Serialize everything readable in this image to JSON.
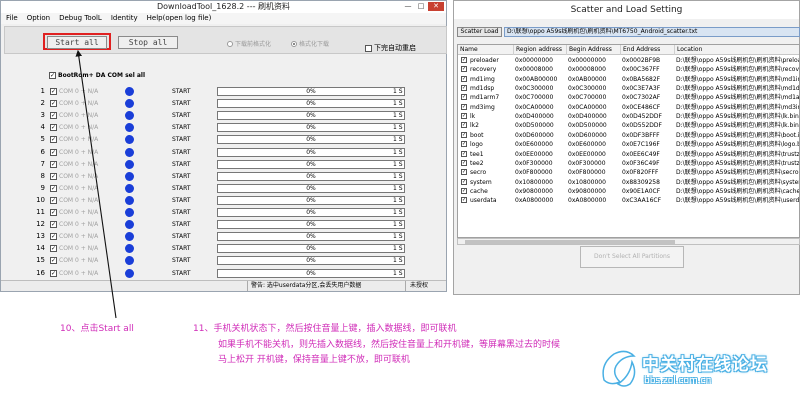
{
  "download_tool": {
    "title": "DownloadTool_1628.2 --- 刷机资料",
    "window_buttons": {
      "minimize": "—",
      "maximize": "□",
      "close": "✕"
    },
    "menu": [
      "File",
      "Option",
      "Debug ToolL",
      "Identity",
      "Help(open log file)"
    ],
    "start_all": "Start all",
    "stop_all": "Stop all",
    "radio_1": "下载前格式化",
    "radio_2": "格式化下载",
    "auto_reboot": "下完自动重启",
    "bootrom_label": "BootRom+ DA COM sel all",
    "ports": [
      {
        "num": "1",
        "label": "COM 0 + N/A",
        "state": "START",
        "progress": "0%",
        "time": "1 S"
      },
      {
        "num": "2",
        "label": "COM 0 + N/A",
        "state": "START",
        "progress": "0%",
        "time": "1 S"
      },
      {
        "num": "3",
        "label": "COM 0 + N/A",
        "state": "START",
        "progress": "0%",
        "time": "1 S"
      },
      {
        "num": "4",
        "label": "COM 0 + N/A",
        "state": "START",
        "progress": "0%",
        "time": "1 S"
      },
      {
        "num": "5",
        "label": "COM 0 + N/A",
        "state": "START",
        "progress": "0%",
        "time": "1 S"
      },
      {
        "num": "6",
        "label": "COM 0 + N/A",
        "state": "START",
        "progress": "0%",
        "time": "1 S"
      },
      {
        "num": "7",
        "label": "COM 0 + N/A",
        "state": "START",
        "progress": "0%",
        "time": "1 S"
      },
      {
        "num": "8",
        "label": "COM 0 + N/A",
        "state": "START",
        "progress": "0%",
        "time": "1 S"
      },
      {
        "num": "9",
        "label": "COM 0 + N/A",
        "state": "START",
        "progress": "0%",
        "time": "1 S"
      },
      {
        "num": "10",
        "label": "COM 0 + N/A",
        "state": "START",
        "progress": "0%",
        "time": "1 S"
      },
      {
        "num": "11",
        "label": "COM 0 + N/A",
        "state": "START",
        "progress": "0%",
        "time": "1 S"
      },
      {
        "num": "12",
        "label": "COM 0 + N/A",
        "state": "START",
        "progress": "0%",
        "time": "1 S"
      },
      {
        "num": "13",
        "label": "COM 0 + N/A",
        "state": "START",
        "progress": "0%",
        "time": "1 S"
      },
      {
        "num": "14",
        "label": "COM 0 + N/A",
        "state": "START",
        "progress": "0%",
        "time": "1 S"
      },
      {
        "num": "15",
        "label": "COM 0 + N/A",
        "state": "START",
        "progress": "0%",
        "time": "1 S"
      },
      {
        "num": "16",
        "label": "COM 0 + N/A",
        "state": "START",
        "progress": "0%",
        "time": "1 S"
      }
    ],
    "status_warning": "警告: 选中userdata分区,会丢失用户数据",
    "status_auth": "未授权"
  },
  "scatter": {
    "title": "Scatter and Load Setting",
    "scatter_button": "Scatter Load",
    "scatter_path": "D:\\联想\\oppo A59s线刷机包\\刷机资料\\MT6750_Android_scatter.txt",
    "columns": [
      "Name",
      "Region address",
      "Begin Address",
      "End Address",
      "Location"
    ],
    "rows": [
      {
        "name": "preloader",
        "region": "0x00000000",
        "begin": "0x00000000",
        "end": "0x0002BF9B",
        "location": "D:\\联想\\oppo A59s线刷机包\\刷机资料\\preloader"
      },
      {
        "name": "recovery",
        "region": "0x00008000",
        "begin": "0x00008000",
        "end": "0x00C367FF",
        "location": "D:\\联想\\oppo A59s线刷机包\\刷机资料\\recovery"
      },
      {
        "name": "md1img",
        "region": "0x00AB00000",
        "begin": "0x0AB00000",
        "end": "0x0BA5682F",
        "location": "D:\\联想\\oppo A59s线刷机包\\刷机资料\\md1img"
      },
      {
        "name": "md1dsp",
        "region": "0x0C300000",
        "begin": "0x0C300000",
        "end": "0x0C3E7A3F",
        "location": "D:\\联想\\oppo A59s线刷机包\\刷机资料\\md1dsp"
      },
      {
        "name": "md1arm7",
        "region": "0x0C700000",
        "begin": "0x0C700000",
        "end": "0x0C7302AF",
        "location": "D:\\联想\\oppo A59s线刷机包\\刷机资料\\md1arm7"
      },
      {
        "name": "md3img",
        "region": "0x0CA00000",
        "begin": "0x0CA00000",
        "end": "0x0CE486CF",
        "location": "D:\\联想\\oppo A59s线刷机包\\刷机资料\\md3img"
      },
      {
        "name": "lk",
        "region": "0x0D400000",
        "begin": "0x0D400000",
        "end": "0x0D452DDF",
        "location": "D:\\联想\\oppo A59s线刷机包\\刷机资料\\lk.bin"
      },
      {
        "name": "lk2",
        "region": "0x0D500000",
        "begin": "0x0D500000",
        "end": "0x0D552DDF",
        "location": "D:\\联想\\oppo A59s线刷机包\\刷机资料\\lk.bin"
      },
      {
        "name": "boot",
        "region": "0x0D600000",
        "begin": "0x0D600000",
        "end": "0x0DF3BFFF",
        "location": "D:\\联想\\oppo A59s线刷机包\\刷机资料\\boot.img"
      },
      {
        "name": "logo",
        "region": "0x0E600000",
        "begin": "0x0E600000",
        "end": "0x0E7C196F",
        "location": "D:\\联想\\oppo A59s线刷机包\\刷机资料\\logo.bin"
      },
      {
        "name": "tee1",
        "region": "0x0EE00000",
        "begin": "0x0EE00000",
        "end": "0x0EE6C49F",
        "location": "D:\\联想\\oppo A59s线刷机包\\刷机资料\\trustzone"
      },
      {
        "name": "tee2",
        "region": "0x0F300000",
        "begin": "0x0F300000",
        "end": "0x0F36C49F",
        "location": "D:\\联想\\oppo A59s线刷机包\\刷机资料\\trustzone"
      },
      {
        "name": "secro",
        "region": "0x0F800000",
        "begin": "0x0F800000",
        "end": "0x0F820FFF",
        "location": "D:\\联想\\oppo A59s线刷机包\\刷机资料\\secro.img"
      },
      {
        "name": "system",
        "region": "0x10800000",
        "begin": "0x10800000",
        "end": "0x88309258",
        "location": "D:\\联想\\oppo A59s线刷机包\\刷机资料\\system"
      },
      {
        "name": "cache",
        "region": "0x90800000",
        "begin": "0x90800000",
        "end": "0x90E1A0CF",
        "location": "D:\\联想\\oppo A59s线刷机包\\刷机资料\\cache"
      },
      {
        "name": "userdata",
        "region": "0xA0800000",
        "begin": "0xA0800000",
        "end": "0xC3AA16CF",
        "location": "D:\\联想\\oppo A59s线刷机包\\刷机资料\\userdata"
      }
    ],
    "deselect_button": "Don't Select All Partitions"
  },
  "annotations": {
    "step10": "10、点击Start all",
    "step11_line1": "11、手机关机状态下，然后按住音量上键，插入数据线，即可联机",
    "step11_line2": "如果手机不能关机，则先插入数据线，然后按住音量上和开机键，等屏幕黑过去的时候",
    "step11_line3": "马上松开 开机键，保持音量上键不放，即可联机"
  },
  "watermark": {
    "text": "中关村在线论坛",
    "url": "bbs.zol.com.cn"
  },
  "colors": {
    "highlight_red": "#e02020",
    "annotation_magenta": "#d02cb8",
    "port_dot_blue": "#1a3ed8",
    "path_field_blue": "#d8e4f2"
  }
}
